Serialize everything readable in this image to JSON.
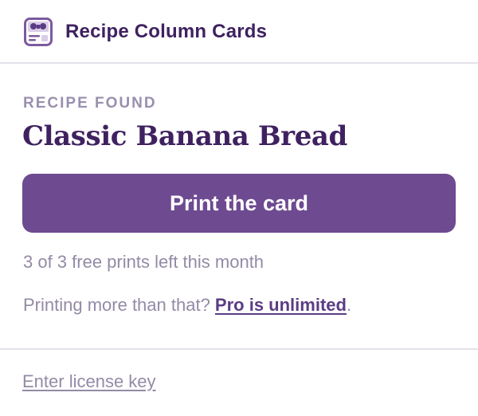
{
  "header": {
    "app_title": "Recipe Column Cards",
    "logo_icon": "recipe-card-logo-icon"
  },
  "recipe": {
    "section_label": "RECIPE FOUND",
    "name": "Classic Banana Bread"
  },
  "actions": {
    "print_label": "Print the card"
  },
  "quota": {
    "text": "3 of 3 free prints left this month"
  },
  "upsell": {
    "prefix": "Printing more than that? ",
    "link_label": "Pro is unlimited",
    "suffix": "."
  },
  "footer": {
    "license_link": "Enter license key"
  },
  "colors": {
    "accent": "#6e4a91",
    "title": "#3f2160",
    "muted": "#948aa6",
    "divider": "#e4e1ea"
  }
}
